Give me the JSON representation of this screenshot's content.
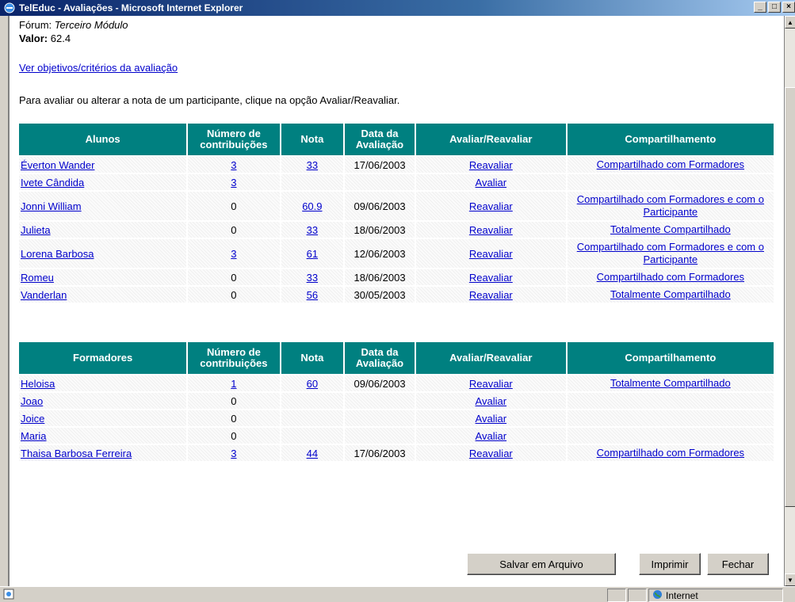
{
  "window": {
    "title": "TelEduc - Avaliações - Microsoft Internet Explorer",
    "minimize": "_",
    "maximize": "□",
    "close": "×"
  },
  "header": {
    "forum_label": "Fórum:",
    "forum_value": "Terceiro Módulo",
    "valor_label": "Valor:",
    "valor_value": "62.4",
    "objectives_link": "Ver objetivos/critérios da avaliação",
    "instructions": "Para avaliar ou alterar a nota de um participante, clique na opção Avaliar/Reavaliar."
  },
  "students_table": {
    "headers": [
      "Alunos",
      "Número de contribuições",
      "Nota",
      "Data da Avaliação",
      "Avaliar/Reavaliar",
      "Compartilhamento"
    ],
    "rows": [
      {
        "name": "Éverton Wander",
        "contrib": "3",
        "nota": "33",
        "data": "17/06/2003",
        "acao": "Reavaliar",
        "share": "Compartilhado com Formadores"
      },
      {
        "name": "Ivete Cândida",
        "contrib": "3",
        "nota": "",
        "data": "",
        "acao": "Avaliar",
        "share": ""
      },
      {
        "name": "Jonni William",
        "contrib": "0",
        "nota": "60.9",
        "data": "09/06/2003",
        "acao": "Reavaliar",
        "share": "Compartilhado com Formadores e com o Participante"
      },
      {
        "name": "Julieta",
        "contrib": "0",
        "nota": "33",
        "data": "18/06/2003",
        "acao": "Reavaliar",
        "share": "Totalmente Compartilhado"
      },
      {
        "name": "Lorena Barbosa",
        "contrib": "3",
        "nota": "61",
        "data": "12/06/2003",
        "acao": "Reavaliar",
        "share": "Compartilhado com Formadores e com o Participante"
      },
      {
        "name": "Romeu",
        "contrib": "0",
        "nota": "33",
        "data": "18/06/2003",
        "acao": "Reavaliar",
        "share": "Compartilhado com Formadores"
      },
      {
        "name": "Vanderlan",
        "contrib": "0",
        "nota": "56",
        "data": "30/05/2003",
        "acao": "Reavaliar",
        "share": "Totalmente Compartilhado"
      }
    ]
  },
  "trainers_table": {
    "headers": [
      "Formadores",
      "Número de contribuições",
      "Nota",
      "Data da Avaliação",
      "Avaliar/Reavaliar",
      "Compartilhamento"
    ],
    "rows": [
      {
        "name": "Heloisa",
        "contrib": "1",
        "nota": "60",
        "data": "09/06/2003",
        "acao": "Reavaliar",
        "share": "Totalmente Compartilhado"
      },
      {
        "name": "Joao",
        "contrib": "0",
        "nota": "",
        "data": "",
        "acao": "Avaliar",
        "share": ""
      },
      {
        "name": "Joice",
        "contrib": "0",
        "nota": "",
        "data": "",
        "acao": "Avaliar",
        "share": ""
      },
      {
        "name": "Maria",
        "contrib": "0",
        "nota": "",
        "data": "",
        "acao": "Avaliar",
        "share": ""
      },
      {
        "name": "Thaisa Barbosa Ferreira",
        "contrib": "3",
        "nota": "44",
        "data": "17/06/2003",
        "acao": "Reavaliar",
        "share": "Compartilhado com Formadores"
      }
    ]
  },
  "buttons": {
    "save": "Salvar em Arquivo",
    "print": "Imprimir",
    "close": "Fechar"
  },
  "statusbar": {
    "zone": "Internet"
  },
  "colors": {
    "header_bg": "#008080",
    "link": "#0000cc"
  }
}
